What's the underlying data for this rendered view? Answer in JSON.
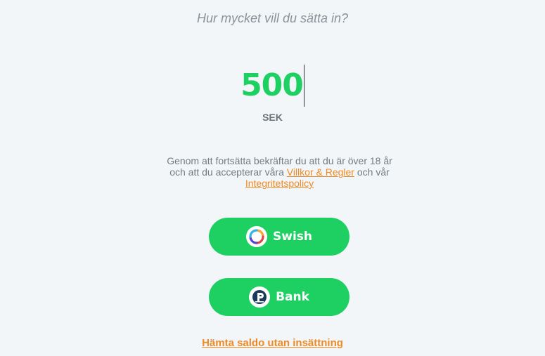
{
  "deposit": {
    "question": "Hur mycket vill du sätta in?",
    "amount": "500",
    "currency": "SEK"
  },
  "terms": {
    "text_before": "Genom att fortsätta bekräftar du att du är över 18 år och att du accepterar våra ",
    "terms_link": "Villkor & Regler",
    "text_middle": " och vår ",
    "privacy_link": "Integritetspolicy"
  },
  "payment_methods": [
    {
      "label": "Swish",
      "icon": "swish-icon"
    },
    {
      "label": "Bank",
      "icon": "trustly-bank-icon"
    }
  ],
  "fetch_balance_link": "Hämta saldo utan insättning",
  "colors": {
    "accent_green": "#1ecf62",
    "link_orange": "#f08a24",
    "background": "#f2f6f9"
  }
}
